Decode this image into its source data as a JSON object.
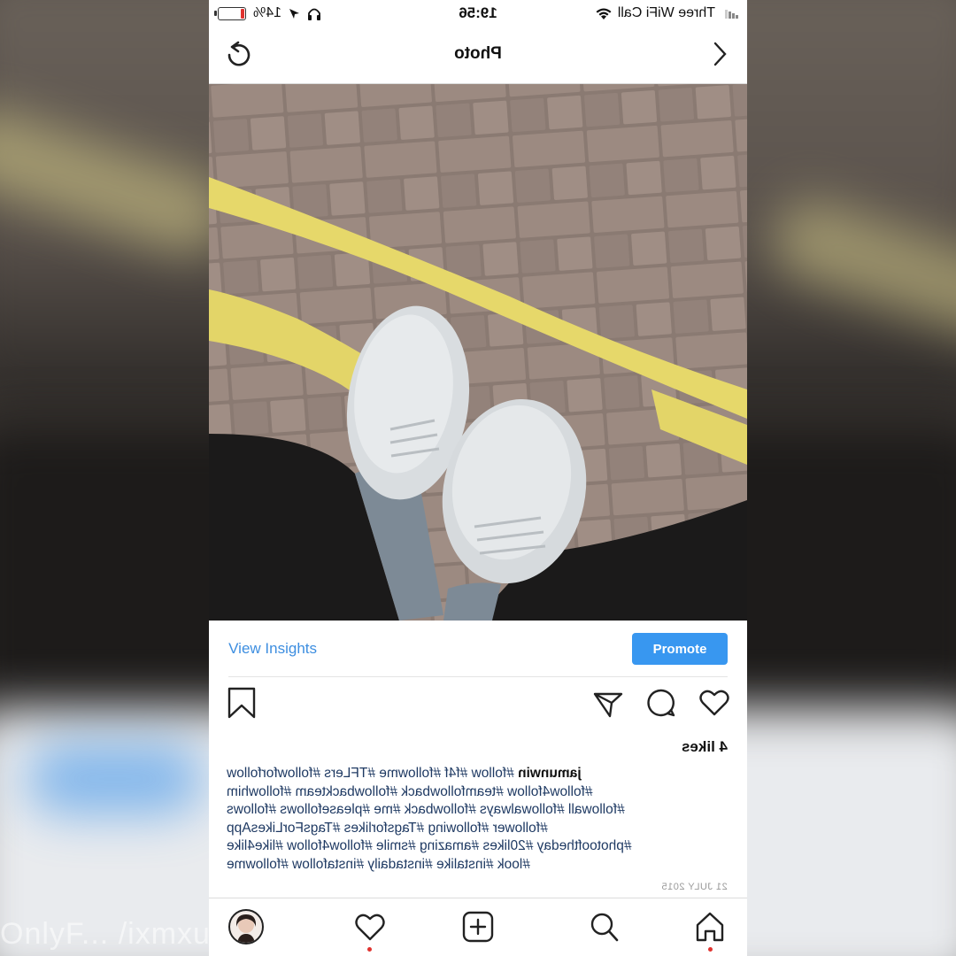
{
  "status_bar": {
    "carrier": "Three WiFi Call",
    "time": "19:56",
    "battery_percent": "14%",
    "battery_level": 0.14
  },
  "nav": {
    "title": "Photo"
  },
  "post": {
    "view_insights_label": "View Insights",
    "promote_label": "Promote",
    "likes": "4 likes",
    "username": "jamunwin",
    "caption_lines": [
      " #follow #f4f #followme #TFLers #followforfollow",
      "#follow4follow #teamfollowback #followbackteam #followhim",
      "#followall #followalways #followback #me #pleasefollows #follows",
      "#follower #following #Tagsforlikes #TagsForLikesApp",
      "#photooftheday #20likes #amazing #smile #follow4follow #like4like",
      "#look #instalike #instadaily #instafollow #followme"
    ],
    "date": "21 JULY 2015"
  },
  "icons": {
    "back": "chevron-left-icon",
    "refresh": "refresh-icon",
    "like": "heart-icon",
    "comment": "comment-icon",
    "share": "send-icon",
    "save": "bookmark-icon",
    "home": "home-icon",
    "search": "search-icon",
    "add": "add-post-icon",
    "activity": "heart-icon",
    "profile": "profile-avatar"
  },
  "colors": {
    "accent": "#3897f0",
    "notification": "#e0332f",
    "hashtag": "#1f3a63"
  },
  "watermark": "OnlyF... /ixmxu"
}
